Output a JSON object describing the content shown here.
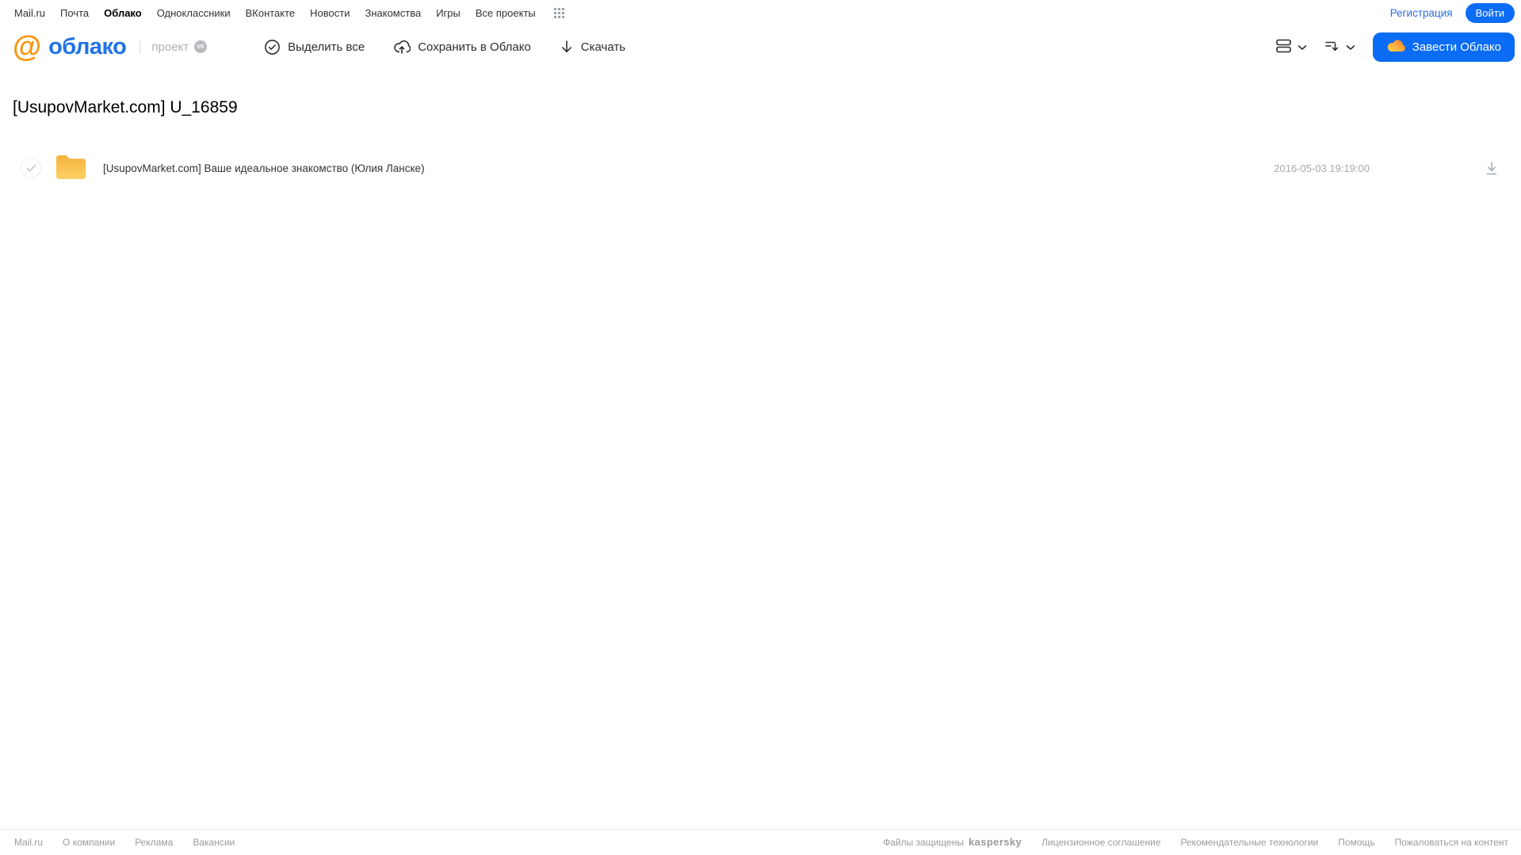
{
  "colors": {
    "accent_blue": "#0b6cf5",
    "logo_orange": "#f79610",
    "logo_blue": "#2173e5",
    "folder_yellow": "#fbc34f",
    "kaspersky_green": "#00a88e"
  },
  "topnav": {
    "items": [
      "Mail.ru",
      "Почта",
      "Облако",
      "Одноклассники",
      "ВКонтакте",
      "Новости",
      "Знакомства",
      "Игры",
      "Все проекты"
    ],
    "active_item": "Облако",
    "registration": "Регистрация",
    "login": "Войти",
    "apps_grid_icon": "grid-icon"
  },
  "header": {
    "logo": {
      "at": "@",
      "name": "облако",
      "project": "проект",
      "vk": "VK"
    },
    "toolbar": {
      "select_all": "Выделить все",
      "save_to_cloud": "Сохранить в Облако",
      "download": "Скачать"
    },
    "view_icons": [
      "list-view-icon",
      "sort-icon"
    ],
    "cta": "Завести Облако"
  },
  "main": {
    "title": "[UsupovMarket.com] U_16859",
    "files": [
      {
        "type": "folder",
        "name": "[UsupovMarket.com] Ваше идеальное знакомство (Юлия Ланске)",
        "date": "2016-05-03 19:19:00"
      }
    ]
  },
  "footer": {
    "left_links": [
      "Mail.ru",
      "О компании",
      "Реклама",
      "Вакансии"
    ],
    "protected_by": "Файлы защищены",
    "kaspersky": "kaspersky",
    "right_links": [
      "Лицензионное соглашение",
      "Рекомендательные технологии",
      "Помощь",
      "Пожаловаться на контент"
    ]
  }
}
